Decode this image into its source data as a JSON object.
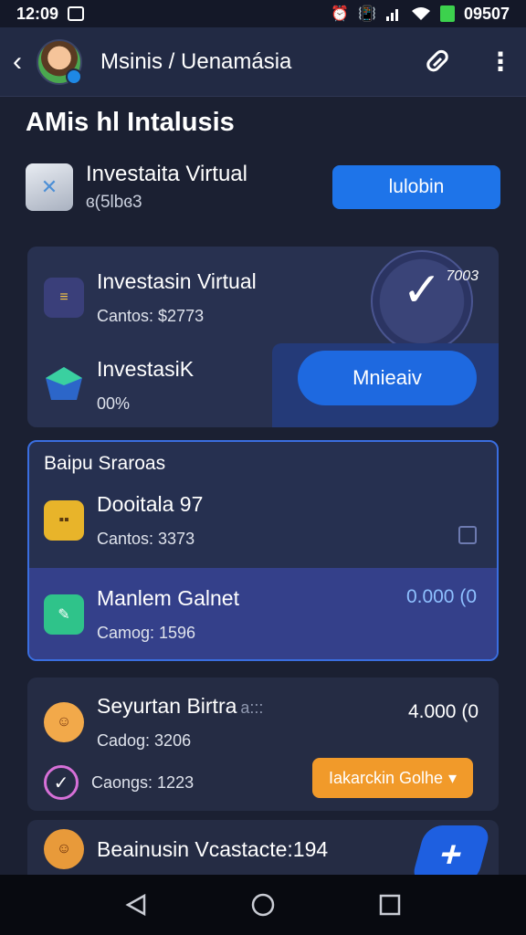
{
  "status_bar": {
    "time": "12:09",
    "right_text": "09507",
    "icons": [
      "notification-icon",
      "alarm-icon",
      "vibrate-icon",
      "signal-icon",
      "wifi-icon",
      "battery-icon"
    ]
  },
  "app_bar": {
    "title": "Msinis / Uenamásia",
    "icons": [
      "back-icon",
      "link-icon",
      "more-vert-icon"
    ]
  },
  "section_heading": "AMis hl Intalusis",
  "top_item": {
    "title": "Investaita Virtual",
    "subtitle": "ɞ(5lbɞ3",
    "button_label": "lulobin"
  },
  "card1": {
    "row1": {
      "title": "Investasin Virtual",
      "subtitle": "Cantos: $2773",
      "check_value": "7003"
    },
    "row2": {
      "title": "InvestasiK",
      "subtitle": "00%",
      "button_label": "Mnieaiv"
    }
  },
  "card2": {
    "header": "Baipu Sraroas",
    "rowA": {
      "title": "Dooitala 97",
      "subtitle": "Cantos: 3373"
    },
    "rowB": {
      "title": "Manlem Galnet",
      "subtitle": "Camog: 1596",
      "value": "0.000 (0"
    }
  },
  "card3": {
    "rowA": {
      "title": "Seyurtan Birtra",
      "title_suffix": "a:::",
      "subtitle": "Cadog: 3206",
      "value": "4.000 (0"
    },
    "rowB": {
      "subtitle": "Caongs: 1223",
      "button_label": "Iakarckin Golhe"
    }
  },
  "card4": {
    "title": "Beainusin Vcastacte:194"
  },
  "colors": {
    "background": "#1b2032",
    "accent": "#1e74e9",
    "orange": "#f19a2a",
    "card": "#283150"
  }
}
